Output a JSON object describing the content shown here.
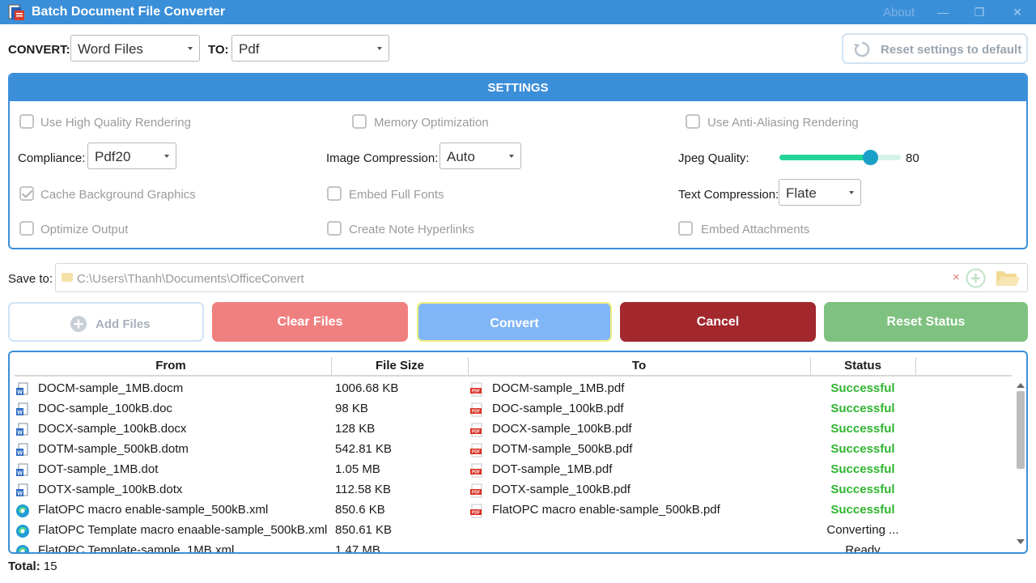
{
  "window": {
    "title": "Batch Document File Converter",
    "about": "About",
    "minimize": "—",
    "maximize": "❐",
    "close": "✕"
  },
  "convert": {
    "label": "CONVERT:",
    "from_value": "Word Files",
    "to_label": "TO:",
    "to_value": "Pdf"
  },
  "reset_settings_label": "Reset settings to default",
  "settings": {
    "header": "SETTINGS",
    "use_high_quality": "Use High Quality Rendering",
    "memory_optimization": "Memory Optimization",
    "anti_aliasing": "Use Anti-Aliasing Rendering",
    "compliance_label": "Compliance:",
    "compliance_value": "Pdf20",
    "image_compression_label": "Image Compression:",
    "image_compression_value": "Auto",
    "jpeg_quality_label": "Jpeg Quality:",
    "jpeg_quality_value": "80",
    "jpeg_quality_fraction": 0.75,
    "cache_background": "Cache Background Graphics",
    "cache_background_checked": true,
    "embed_fonts": "Embed Full Fonts",
    "text_compression_label": "Text Compression:",
    "text_compression_value": "Flate",
    "optimize_output": "Optimize Output",
    "note_hyperlinks": "Create Note Hyperlinks",
    "embed_attachments": "Embed Attachments"
  },
  "save": {
    "label": "Save to:",
    "path": "C:\\Users\\Thanh\\Documents\\OfficeConvert",
    "clear_glyph": "×"
  },
  "buttons": {
    "add_files": "Add Files",
    "clear_files": "Clear Files",
    "convert": "Convert",
    "cancel": "Cancel",
    "reset_status": "Reset Status"
  },
  "table": {
    "headers": {
      "from": "From",
      "size": "File Size",
      "to": "To",
      "status": "Status"
    },
    "rows": [
      {
        "from": "DOCM-sample_1MB.docm",
        "icon": "word-doc-icon",
        "size": "1006.68 KB",
        "to": "DOCM-sample_1MB.pdf",
        "status": "Successful"
      },
      {
        "from": "DOC-sample_100kB.doc",
        "icon": "word-doc-icon",
        "size": "98 KB",
        "to": "DOC-sample_100kB.pdf",
        "status": "Successful"
      },
      {
        "from": "DOCX-sample_100kB.docx",
        "icon": "word-doc-icon",
        "size": "128 KB",
        "to": "DOCX-sample_100kB.pdf",
        "status": "Successful"
      },
      {
        "from": "DOTM-sample_500kB.dotm",
        "icon": "word-doc-icon",
        "size": "542.81 KB",
        "to": "DOTM-sample_500kB.pdf",
        "status": "Successful"
      },
      {
        "from": "DOT-sample_1MB.dot",
        "icon": "word-doc-icon",
        "size": "1.05 MB",
        "to": "DOT-sample_1MB.pdf",
        "status": "Successful"
      },
      {
        "from": "DOTX-sample_100kB.dotx",
        "icon": "word-doc-icon",
        "size": "112.58 KB",
        "to": "DOTX-sample_100kB.pdf",
        "status": "Successful"
      },
      {
        "from": "FlatOPC macro enable-sample_500kB.xml",
        "icon": "edge-xml-icon",
        "size": "850.6 KB",
        "to": "FlatOPC macro enable-sample_500kB.pdf",
        "status": "Successful"
      },
      {
        "from": "FlatOPC Template macro enaable-sample_500kB.xml",
        "icon": "edge-xml-icon",
        "size": "850.61 KB",
        "to": "",
        "status": "Converting ..."
      },
      {
        "from": "FlatOPC Template-sample_1MB.xml",
        "icon": "edge-xml-icon",
        "size": "1.47 MB",
        "to": "",
        "status": "Ready"
      }
    ]
  },
  "total": {
    "label": "Total:",
    "value": "15"
  }
}
